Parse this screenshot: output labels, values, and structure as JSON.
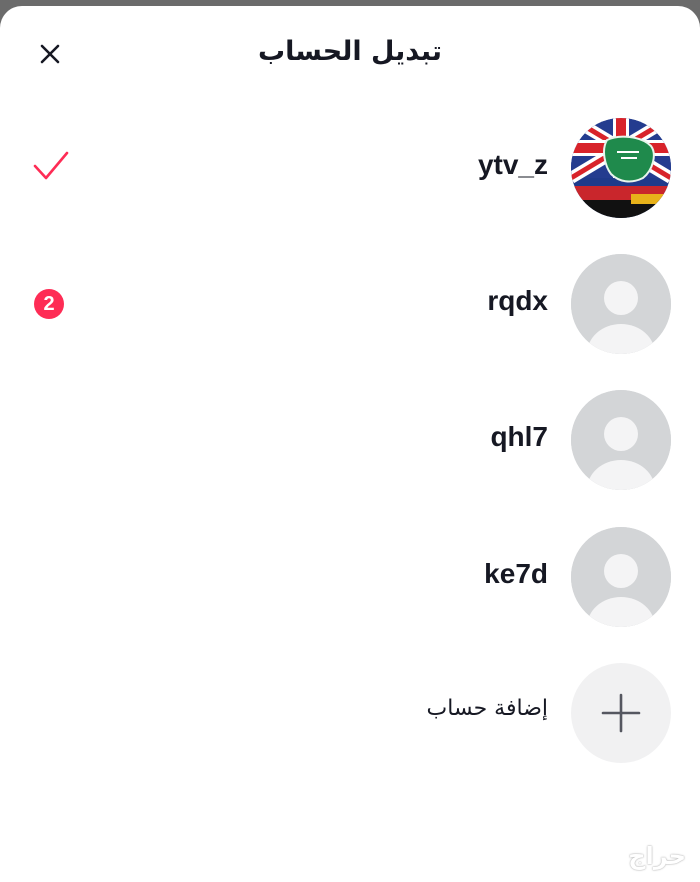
{
  "header": {
    "title": "تبديل الحساب",
    "close_icon": "close-icon"
  },
  "accounts": [
    {
      "username": "ytv_z",
      "avatar": "flags-avatar",
      "selected": true,
      "status_icon": "checkmark-icon"
    },
    {
      "username": "rqdx",
      "avatar": "default-avatar",
      "badge": "2"
    },
    {
      "username": "qhl7",
      "avatar": "default-avatar"
    },
    {
      "username": "ke7d",
      "avatar": "default-avatar"
    }
  ],
  "add_account": {
    "label": "إضافة حساب",
    "icon": "plus-icon"
  },
  "watermark": "حراج",
  "colors": {
    "accent": "#fe2c55",
    "text": "#161823",
    "avatar_bg": "#d3d5d7",
    "add_bg": "#f1f1f2"
  }
}
